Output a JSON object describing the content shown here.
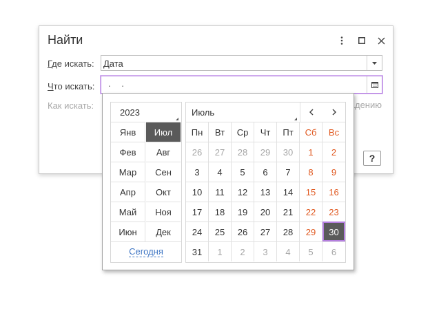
{
  "dialog": {
    "title": "Найти",
    "labels": {
      "where_prefix": "Г",
      "where_rest": "де искать:",
      "what_prefix": "Ч",
      "what_rest": "то искать:",
      "how": "Как искать:"
    },
    "where_value": "Дата",
    "what_value": ". .",
    "right_fragment": "адению",
    "help_label": "?"
  },
  "calendar": {
    "year": "2023",
    "month": "Июль",
    "months": [
      [
        "Янв",
        "Июл"
      ],
      [
        "Фев",
        "Авг"
      ],
      [
        "Мар",
        "Сен"
      ],
      [
        "Апр",
        "Окт"
      ],
      [
        "Май",
        "Ноя"
      ],
      [
        "Июн",
        "Дек"
      ]
    ],
    "selected_month": "Июл",
    "today_label": "Сегодня",
    "weekdays": [
      "Пн",
      "Вт",
      "Ср",
      "Чт",
      "Пт",
      "Сб",
      "Вс"
    ],
    "weeks": [
      [
        "26",
        "27",
        "28",
        "29",
        "30",
        "1",
        "2"
      ],
      [
        "3",
        "4",
        "5",
        "6",
        "7",
        "8",
        "9"
      ],
      [
        "10",
        "11",
        "12",
        "13",
        "14",
        "15",
        "16"
      ],
      [
        "17",
        "18",
        "19",
        "20",
        "21",
        "22",
        "23"
      ],
      [
        "24",
        "25",
        "26",
        "27",
        "28",
        "29",
        "30"
      ],
      [
        "31",
        "1",
        "2",
        "3",
        "4",
        "5",
        "6"
      ]
    ],
    "selected_day": "30",
    "colors": {
      "weekend": "#e0581f",
      "other_month": "#a6a6a6",
      "selected_bg": "#5a5a5a",
      "focus": "#b57fe0",
      "link": "#3f76c4"
    }
  }
}
